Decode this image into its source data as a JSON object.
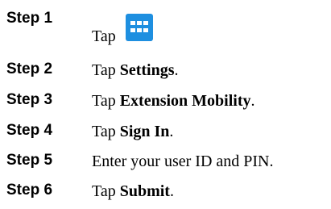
{
  "steps": [
    {
      "label": "Step 1",
      "prefix": "Tap ",
      "suffix": ".",
      "icon": "apps-grid-icon"
    },
    {
      "label": "Step 2",
      "prefix": "Tap ",
      "bold": "Settings",
      "suffix": "."
    },
    {
      "label": "Step 3",
      "prefix": "Tap ",
      "bold": "Extension Mobility",
      "suffix": "."
    },
    {
      "label": "Step 4",
      "prefix": "Tap ",
      "bold": "Sign In",
      "suffix": "."
    },
    {
      "label": "Step 5",
      "text": "Enter your user ID and PIN."
    },
    {
      "label": "Step 6",
      "prefix": "Tap ",
      "bold": "Submit",
      "suffix": "."
    }
  ],
  "colors": {
    "icon_background": "#1e8fe0",
    "icon_foreground": "#ffffff"
  }
}
